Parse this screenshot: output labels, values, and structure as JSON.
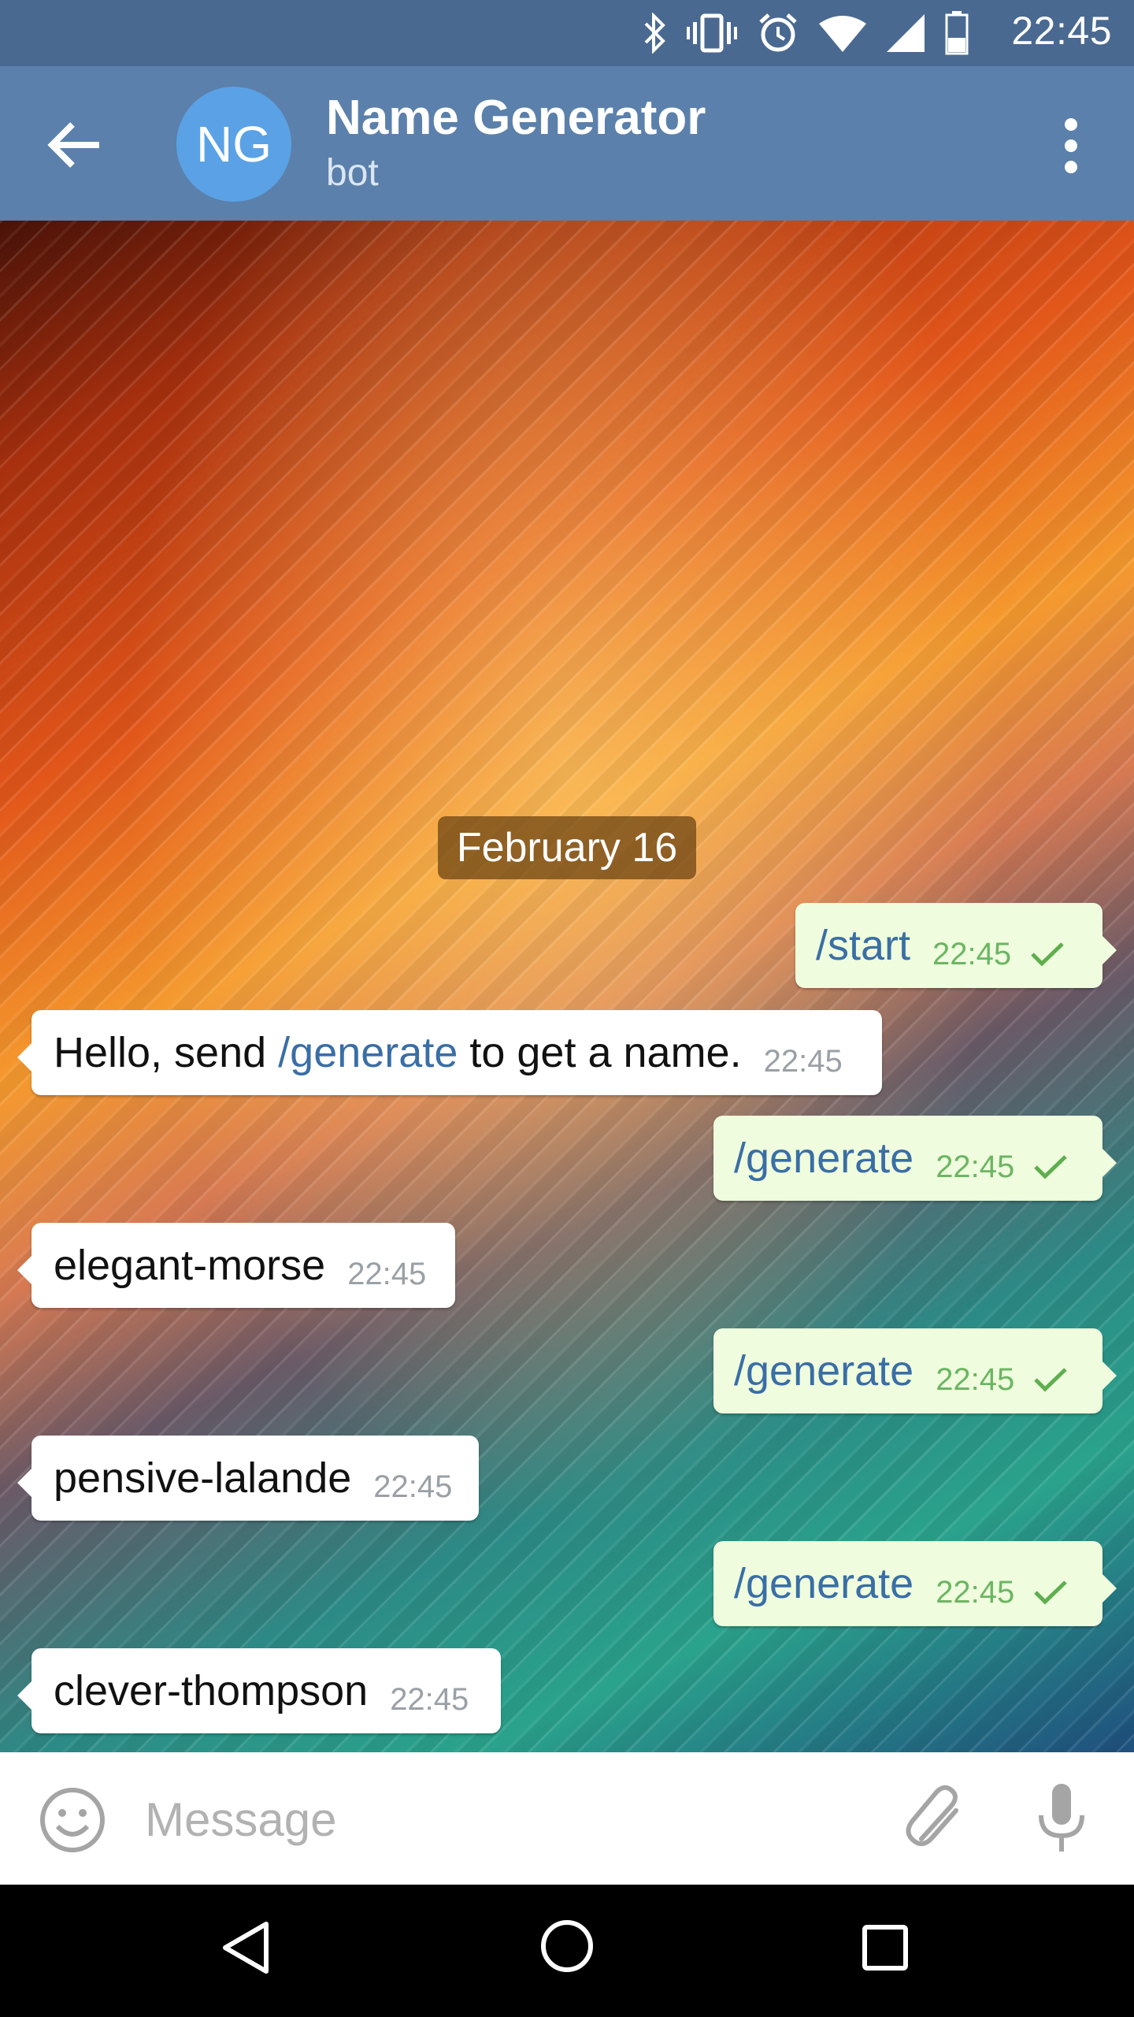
{
  "status_bar": {
    "time": "22:45",
    "icons": [
      "bluetooth-icon",
      "vibrate-icon",
      "alarm-icon",
      "wifi-icon",
      "signal-icon",
      "battery-icon"
    ]
  },
  "header": {
    "avatar_initials": "NG",
    "title": "Name Generator",
    "subtitle": "bot",
    "icons": [
      "back-arrow-icon",
      "more-vert-icon"
    ]
  },
  "chat": {
    "date_label": "February 16",
    "messages": [
      {
        "direction": "out",
        "text": "/start",
        "time": "22:45"
      },
      {
        "direction": "in",
        "text_before": "Hello, send ",
        "command": "/generate",
        "text_after": " to get a name.",
        "time": "22:45"
      },
      {
        "direction": "out",
        "text": "/generate",
        "time": "22:45"
      },
      {
        "direction": "in",
        "text": "elegant-morse",
        "time": "22:45"
      },
      {
        "direction": "out",
        "text": "/generate",
        "time": "22:45"
      },
      {
        "direction": "in",
        "text": "pensive-lalande",
        "time": "22:45"
      },
      {
        "direction": "out",
        "text": "/generate",
        "time": "22:45"
      },
      {
        "direction": "in",
        "text": "clever-thompson",
        "time": "22:45"
      }
    ]
  },
  "composer": {
    "placeholder": "Message",
    "icons": [
      "emoji-icon",
      "attach-icon",
      "mic-icon"
    ]
  },
  "nav_bar": {
    "icons": [
      "nav-back-icon",
      "nav-home-icon",
      "nav-recents-icon"
    ]
  },
  "colors": {
    "status_bar": "#4a6991",
    "app_bar": "#5b80ab",
    "avatar": "#5aa2e5",
    "outgoing_bubble": "#effdde",
    "incoming_bubble": "#ffffff",
    "command_link": "#3a6ea5",
    "outgoing_time": "#6db563"
  }
}
